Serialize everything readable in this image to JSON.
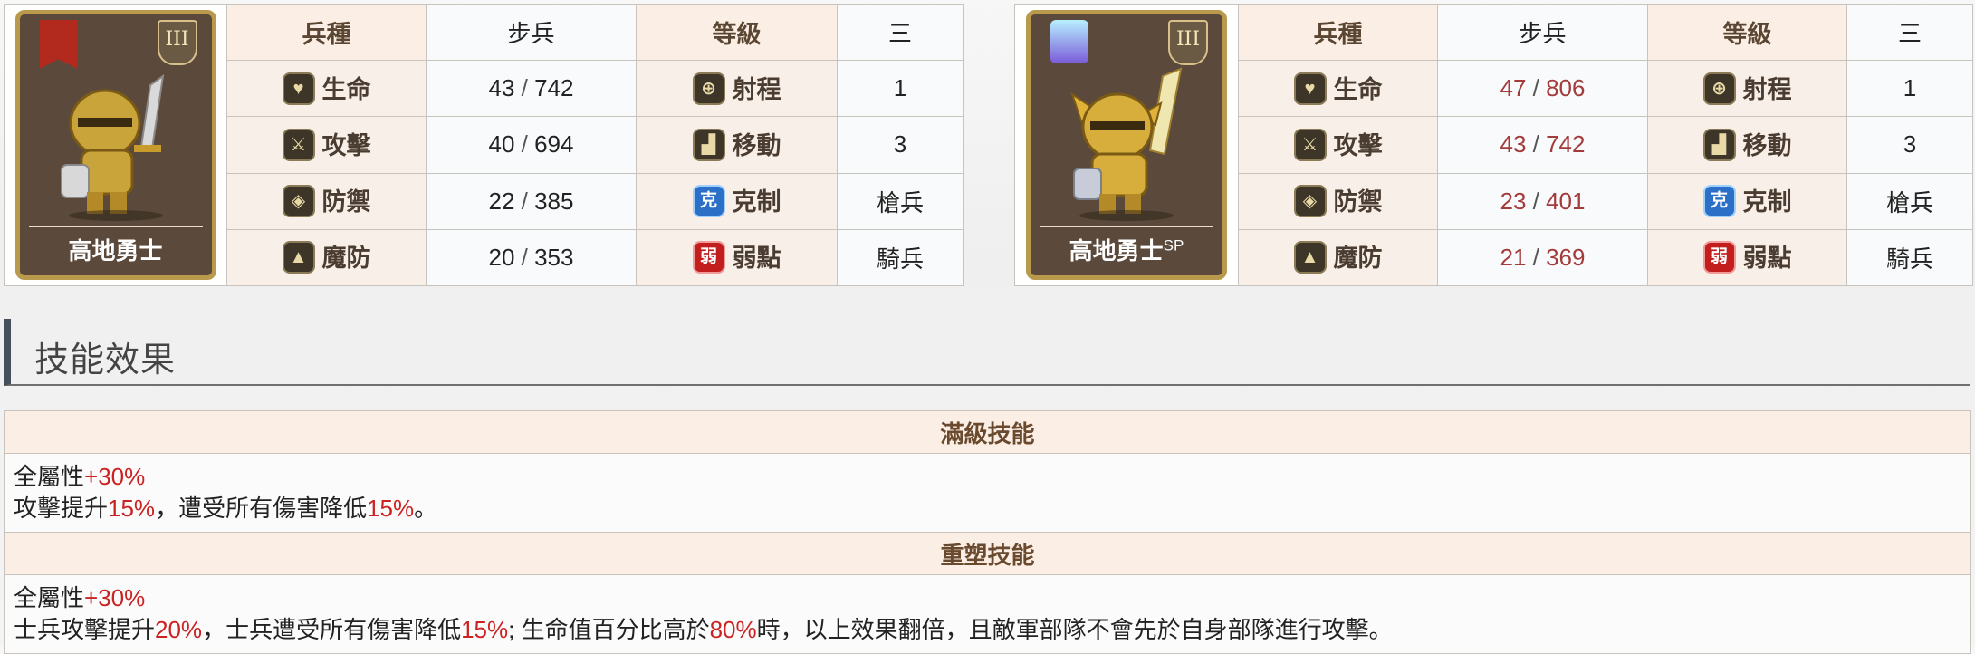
{
  "units": [
    {
      "name": "高地勇士",
      "name_sup": "",
      "rank": "III",
      "type_label": "兵種",
      "type_value": "步兵",
      "level_label": "等級",
      "level_value": "三",
      "stats": [
        {
          "icon": "heart-icon",
          "label": "生命",
          "value": "43",
          "max": "742",
          "right_icon": "crosshair-icon",
          "right_label": "射程",
          "right_value": "1"
        },
        {
          "icon": "sword-icon",
          "label": "攻擊",
          "value": "40",
          "max": "694",
          "right_icon": "boot-icon",
          "right_label": "移動",
          "right_value": "3"
        },
        {
          "icon": "shield-icon",
          "label": "防禦",
          "value": "22",
          "max": "385",
          "right_icon": "counter-icon",
          "right_badge": "克",
          "right_label": "克制",
          "right_value": "槍兵"
        },
        {
          "icon": "hat-icon",
          "label": "魔防",
          "value": "20",
          "max": "353",
          "right_icon": "weakness-icon",
          "right_badge": "弱",
          "right_label": "弱點",
          "right_value": "騎兵"
        }
      ],
      "accent": "#222222"
    },
    {
      "name": "高地勇士",
      "name_sup": "SP",
      "rank": "III",
      "type_label": "兵種",
      "type_value": "步兵",
      "level_label": "等級",
      "level_value": "三",
      "stats": [
        {
          "icon": "heart-icon",
          "label": "生命",
          "value": "47",
          "max": "806",
          "right_icon": "crosshair-icon",
          "right_label": "射程",
          "right_value": "1"
        },
        {
          "icon": "sword-icon",
          "label": "攻擊",
          "value": "43",
          "max": "742",
          "right_icon": "boot-icon",
          "right_label": "移動",
          "right_value": "3"
        },
        {
          "icon": "shield-icon",
          "label": "防禦",
          "value": "23",
          "max": "401",
          "right_icon": "counter-icon",
          "right_badge": "克",
          "right_label": "克制",
          "right_value": "槍兵"
        },
        {
          "icon": "hat-icon",
          "label": "魔防",
          "value": "21",
          "max": "369",
          "right_icon": "weakness-icon",
          "right_badge": "弱",
          "right_label": "弱點",
          "right_value": "騎兵"
        }
      ],
      "accent": "#a43b3b"
    }
  ],
  "section": {
    "title": "技能效果"
  },
  "skills": [
    {
      "header": "滿級技能",
      "lines": [
        [
          {
            "t": "全屬性"
          },
          {
            "t": "+30%",
            "hl": true
          }
        ],
        [
          {
            "t": "攻擊提升"
          },
          {
            "t": "15%",
            "hl": true
          },
          {
            "t": "，遭受所有傷害降低"
          },
          {
            "t": "15%",
            "hl": true
          },
          {
            "t": "。"
          }
        ]
      ]
    },
    {
      "header": "重塑技能",
      "lines": [
        [
          {
            "t": "全屬性"
          },
          {
            "t": "+30%",
            "hl": true
          }
        ],
        [
          {
            "t": "士兵攻擊提升"
          },
          {
            "t": "20%",
            "hl": true
          },
          {
            "t": "，士兵遭受所有傷害降低"
          },
          {
            "t": "15%",
            "hl": true
          },
          {
            "t": "; 生命值百分比高於"
          },
          {
            "t": "80%",
            "hl": true
          },
          {
            "t": "時，以上效果翻倍，且敵軍部隊不會先於自身部隊進行攻擊。"
          }
        ]
      ]
    }
  ],
  "colors": {
    "highlight": "#cc2222",
    "header_bg": "#fbeee4",
    "border": "#c9c3bd"
  }
}
